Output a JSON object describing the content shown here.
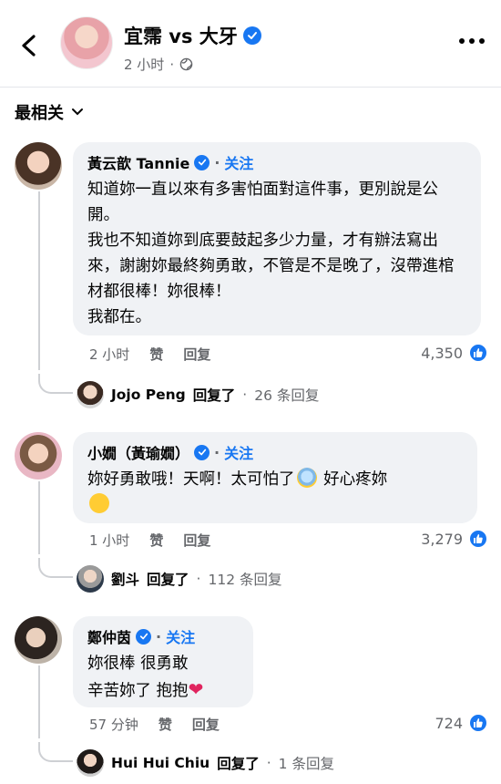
{
  "header": {
    "title": "宜霈 vs 大牙",
    "time": "2 小时",
    "separator": "·",
    "icons": [
      "back-arrow-icon",
      "verified-badge-icon",
      "globe-icon",
      "more-dots-icon"
    ]
  },
  "sort": {
    "label": "最相关"
  },
  "comments": [
    {
      "name": "黃云歆 Tannie",
      "follow": "关注",
      "text": "知道妳一直以來有多害怕面對這件事，更別說是公開。\n我也不知道妳到底要鼓起多少力量，才有辦法寫出來，謝謝妳最終夠勇敢，不管是不是晚了，沒帶進棺材都很棒！妳很棒！\n我都在。",
      "time": "2 小时",
      "like": "赞",
      "reply": "回复",
      "reactions": "4,350",
      "reply_summary": {
        "name": "Jojo Peng",
        "verb": "回复了",
        "count": "26 条回复"
      }
    },
    {
      "name": "小嫺（黃瑜嫺）",
      "follow": "关注",
      "text_part1": "妳好勇敢哦！天啊！太可怕了",
      "text_part2": " 好心疼妳",
      "time": "1 小时",
      "like": "赞",
      "reply": "回复",
      "reactions": "3,279",
      "reply_summary": {
        "name": "劉斗",
        "verb": "回复了",
        "count": "112 条回复"
      }
    },
    {
      "name": "鄭仲茵",
      "follow": "关注",
      "text_line1": "妳很棒 很勇敢",
      "text_line2": "辛苦妳了 抱抱",
      "time": "57 分钟",
      "like": "赞",
      "reply": "回复",
      "reactions": "724",
      "reply_summary": {
        "name": "Hui Hui Chiu",
        "verb": "回复了",
        "count": "1 条回复"
      }
    }
  ],
  "colors": {
    "accent": "#1877f2",
    "bubble": "#f0f2f5",
    "muted": "#65676b"
  }
}
